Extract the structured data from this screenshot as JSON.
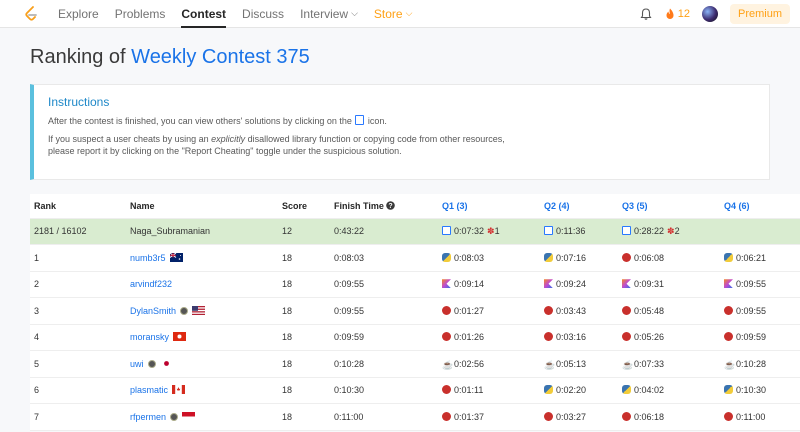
{
  "nav": {
    "items": [
      {
        "label": "Explore",
        "active": false
      },
      {
        "label": "Problems",
        "active": false
      },
      {
        "label": "Contest",
        "active": true
      },
      {
        "label": "Discuss",
        "active": false
      }
    ],
    "interview": "Interview",
    "store": "Store",
    "streak": "12",
    "premium": "Premium"
  },
  "page": {
    "title_prefix": "Ranking of ",
    "contest_name": "Weekly Contest 375"
  },
  "instructions": {
    "heading": "Instructions",
    "line1_before": "After the contest is finished, you can view others' solutions by clicking on the",
    "line1_after": "icon.",
    "line2_a": "If you suspect a user cheats by using an ",
    "line2_em": "explicitly",
    "line2_b": " disallowed library function or copying code from other resources,",
    "line3": "please report it by clicking on the \"Report Cheating\" toggle under the suspicious solution."
  },
  "table": {
    "headers": {
      "rank": "Rank",
      "name": "Name",
      "score": "Score",
      "finish": "Finish Time",
      "q1": "Q1 (3)",
      "q2": "Q2 (4)",
      "q3": "Q3 (5)",
      "q4": "Q4 (6)"
    },
    "my_row": {
      "rank": "2181 / 16102",
      "name": "Naga_Subramanian",
      "score": "12",
      "finish": "0:43:22",
      "q1": {
        "lang": "code",
        "time": "0:07:32",
        "bugs": "1"
      },
      "q2": {
        "lang": "code",
        "time": "0:11:36",
        "bugs": ""
      },
      "q3": {
        "lang": "code",
        "time": "0:28:22",
        "bugs": "2"
      },
      "q4": {
        "lang": "",
        "time": "",
        "bugs": ""
      }
    },
    "rows": [
      {
        "rank": "1",
        "name": "numb3r5",
        "flag": "au",
        "badge": false,
        "score": "18",
        "finish": "0:08:03",
        "q1": {
          "lang": "py",
          "time": "0:08:03"
        },
        "q2": {
          "lang": "py",
          "time": "0:07:16"
        },
        "q3": {
          "lang": "cpp",
          "time": "0:06:08"
        },
        "q4": {
          "lang": "py",
          "time": "0:06:21"
        }
      },
      {
        "rank": "2",
        "name": "arvindf232",
        "flag": "",
        "badge": false,
        "score": "18",
        "finish": "0:09:55",
        "q1": {
          "lang": "kt",
          "time": "0:09:14"
        },
        "q2": {
          "lang": "kt",
          "time": "0:09:24"
        },
        "q3": {
          "lang": "kt",
          "time": "0:09:31"
        },
        "q4": {
          "lang": "kt",
          "time": "0:09:55"
        }
      },
      {
        "rank": "3",
        "name": "DylanSmith",
        "flag": "us",
        "badge": true,
        "score": "18",
        "finish": "0:09:55",
        "q1": {
          "lang": "cpp",
          "time": "0:01:27"
        },
        "q2": {
          "lang": "cpp",
          "time": "0:03:43"
        },
        "q3": {
          "lang": "cpp",
          "time": "0:05:48"
        },
        "q4": {
          "lang": "cpp",
          "time": "0:09:55"
        }
      },
      {
        "rank": "4",
        "name": "moransky",
        "flag": "hk",
        "badge": false,
        "score": "18",
        "finish": "0:09:59",
        "q1": {
          "lang": "cpp",
          "time": "0:01:26"
        },
        "q2": {
          "lang": "cpp",
          "time": "0:03:16"
        },
        "q3": {
          "lang": "cpp",
          "time": "0:05:26"
        },
        "q4": {
          "lang": "cpp",
          "time": "0:09:59"
        }
      },
      {
        "rank": "5",
        "name": "uwi",
        "flag": "jp",
        "badge": true,
        "score": "18",
        "finish": "0:10:28",
        "q1": {
          "lang": "java",
          "time": "0:02:56"
        },
        "q2": {
          "lang": "java",
          "time": "0:05:13"
        },
        "q3": {
          "lang": "java",
          "time": "0:07:33"
        },
        "q4": {
          "lang": "java",
          "time": "0:10:28"
        }
      },
      {
        "rank": "6",
        "name": "plasmatic",
        "flag": "ca",
        "badge": false,
        "score": "18",
        "finish": "0:10:30",
        "q1": {
          "lang": "cpp",
          "time": "0:01:11"
        },
        "q2": {
          "lang": "py",
          "time": "0:02:20"
        },
        "q3": {
          "lang": "py",
          "time": "0:04:02"
        },
        "q4": {
          "lang": "py",
          "time": "0:10:30"
        }
      },
      {
        "rank": "7",
        "name": "rfpermen",
        "flag": "id",
        "badge": true,
        "score": "18",
        "finish": "0:11:00",
        "q1": {
          "lang": "cpp",
          "time": "0:01:37"
        },
        "q2": {
          "lang": "cpp",
          "time": "0:03:27"
        },
        "q3": {
          "lang": "cpp",
          "time": "0:06:18"
        },
        "q4": {
          "lang": "cpp",
          "time": "0:11:00"
        }
      }
    ]
  },
  "colors": {
    "accent": "#1a73e8",
    "brand": "#ffa116",
    "my_row_bg": "#d9ecd0"
  }
}
